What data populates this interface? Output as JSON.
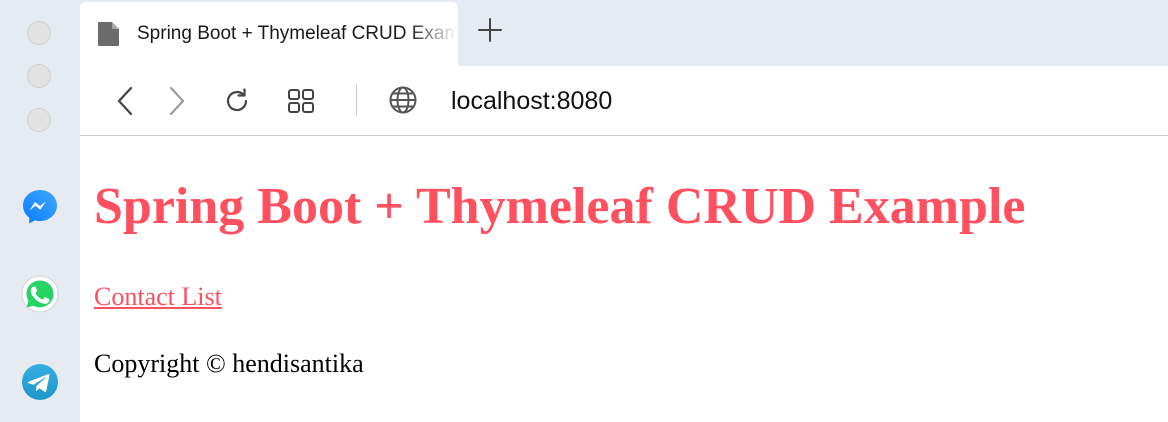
{
  "browser": {
    "tab": {
      "title": "Spring Boot + Thymeleaf CRUD Example",
      "icon": "document-icon"
    },
    "toolbar": {
      "back_icon": "chevron-left-icon",
      "forward_icon": "chevron-right-icon",
      "reload_icon": "reload-icon",
      "tabs_grid_icon": "grid-icon",
      "site_icon": "globe-icon",
      "url": "localhost:8080"
    },
    "new_tab_icon": "plus-icon"
  },
  "sidebar": {
    "apps": [
      {
        "name": "messenger",
        "color": "#1e88ff"
      },
      {
        "name": "whatsapp",
        "color": "#25d366"
      },
      {
        "name": "telegram",
        "color": "#2aa3e0"
      }
    ]
  },
  "page": {
    "title": "Spring Boot + Thymeleaf CRUD Example",
    "link": "Contact List",
    "footer": "Copyright © hendisantika",
    "accent_color": "#ff5060"
  }
}
